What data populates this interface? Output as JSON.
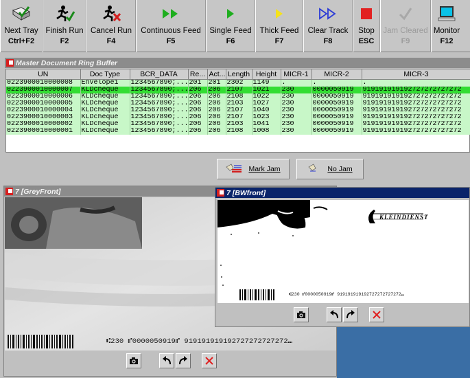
{
  "toolbar": {
    "buttons": [
      {
        "label": "Next Tray",
        "key": "Ctrl+F2",
        "icon": "tray-check-icon"
      },
      {
        "label": "Finish Run",
        "key": "F2",
        "icon": "runner-check-icon"
      },
      {
        "label": "Cancel Run",
        "key": "F4",
        "icon": "runner-x-icon"
      },
      {
        "label": "Continuous Feed",
        "key": "F5",
        "icon": "double-play-icon"
      },
      {
        "label": "Single Feed",
        "key": "F6",
        "icon": "play-icon"
      },
      {
        "label": "Thick Feed",
        "key": "F7",
        "icon": "yellow-play-icon"
      },
      {
        "label": "Clear Track",
        "key": "F8",
        "icon": "outline-double-play-icon"
      },
      {
        "label": "Stop",
        "key": "ESC",
        "icon": "stop-icon"
      },
      {
        "label": "Jam Cleared",
        "key": "F9",
        "icon": "checkmark-icon"
      },
      {
        "label": "Monitor",
        "key": "F12",
        "icon": "monitor-icon"
      }
    ]
  },
  "ring_buffer": {
    "title": "Master Document Ring Buffer",
    "columns": [
      "UN",
      "Doc Type",
      "BCR_DATA",
      "Re...",
      "Act...",
      "Length",
      "Height",
      "MICR-1",
      "MICR-2",
      "MICR-3"
    ],
    "rows": [
      [
        "0223900010000008",
        "Envelope1",
        "1234567890;...",
        "201",
        "201",
        "2302",
        "1149",
        ".",
        ".",
        "."
      ],
      [
        "0223900010000007",
        "KLDcheque",
        "1234567890;...",
        "206",
        "206",
        "2107",
        "1021",
        "230",
        "0000050919",
        "919191919192727272727272"
      ],
      [
        "0223900010000006",
        "KLDcheque",
        "1234567890;...",
        "206",
        "206",
        "2108",
        "1022",
        "230",
        "0000050919",
        "919191919192727272727272"
      ],
      [
        "0223900010000005",
        "KLDcheque",
        "1234567890;...",
        "206",
        "206",
        "2103",
        "1027",
        "230",
        "0000050919",
        "919191919192727272727272"
      ],
      [
        "0223900010000004",
        "KLDcheque",
        "1234567890;...",
        "206",
        "206",
        "2107",
        "1040",
        "230",
        "0000050919",
        "919191919192727272727272"
      ],
      [
        "0223900010000003",
        "KLDcheque",
        "1234567890;...",
        "206",
        "206",
        "2107",
        "1023",
        "230",
        "0000050919",
        "919191919192727272727272"
      ],
      [
        "0223900010000002",
        "KLDcheque",
        "1234567890;...",
        "206",
        "206",
        "2103",
        "1041",
        "230",
        "0000050919",
        "919191919192727272727272"
      ],
      [
        "0223900010000001",
        "KLDcheque",
        "1234567890;...",
        "206",
        "206",
        "2108",
        "1008",
        "230",
        "0000050919",
        "919191919192727272727272"
      ]
    ],
    "selected_row": 1
  },
  "jam": {
    "mark_jam": "Mark Jam",
    "no_jam": "No Jam"
  },
  "grey_front": {
    "title": "7 [GreyFront]",
    "micr": "⑆230 ⑈0000050919⑈ 919191919192727272727272⑉"
  },
  "bw_front": {
    "title": "7 [BWfront]",
    "logo": "KLEINDIENST",
    "micr": "⑆230 ⑈0000050919⑈ 919191919192727272727272⑉"
  },
  "colors": {
    "row_bg": "#c8f7c8",
    "row_selected": "#33dd33",
    "active_title": "#0a246a",
    "inactive_title": "#8c8c8c",
    "desktop": "#3a6ea5"
  }
}
